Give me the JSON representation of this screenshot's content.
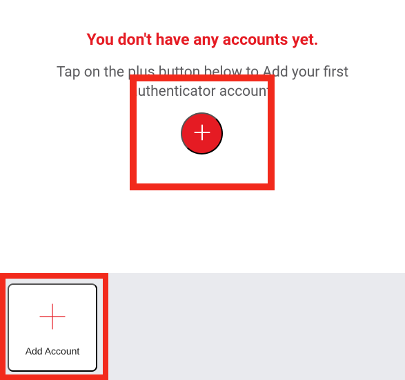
{
  "main": {
    "title": "You don't have any accounts yet.",
    "subtitle": "Tap on the plus button below to Add your first authenticator account."
  },
  "icons": {
    "plus_circle": "plus",
    "plus_thin": "plus"
  },
  "bottom": {
    "add_account_label": "Add Account"
  },
  "colors": {
    "accent": "#e51b23",
    "highlight_border": "#f22a1c",
    "subtitle_text": "#5b5b5e",
    "bottom_bg": "#e9eaee"
  }
}
